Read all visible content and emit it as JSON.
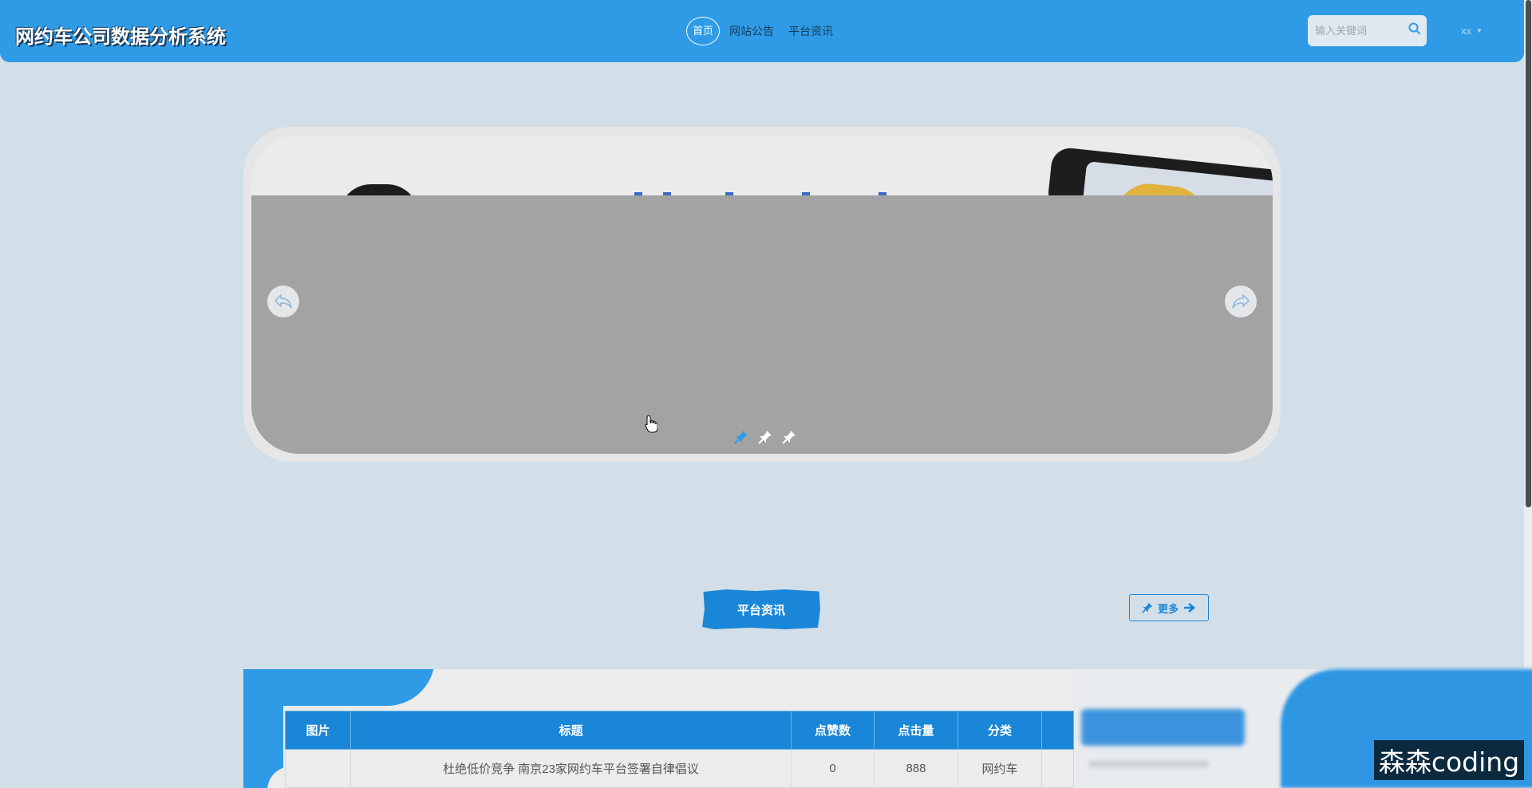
{
  "header": {
    "site_title": "网约车公司数据分析系统",
    "nav": [
      {
        "label": "首页",
        "active": true
      },
      {
        "label": "网站公告",
        "active": false
      },
      {
        "label": "平台资讯",
        "active": false
      }
    ],
    "search_placeholder": "输入关键词",
    "user_label": "xx"
  },
  "banner": {
    "slide_count": 3,
    "active_slide": 1
  },
  "section": {
    "title": "平台资讯",
    "more_label": "更多"
  },
  "news_table": {
    "columns": [
      "图片",
      "标题",
      "点赞数",
      "点击量",
      "分类"
    ],
    "rows": [
      [
        "",
        "杜绝低价竞争 南京23家网约车平台签署自律倡议",
        "0",
        "888",
        "网约车"
      ]
    ]
  },
  "watermark": "森森coding",
  "colors": {
    "primary": "#2f9be6",
    "accent": "#1a86d7",
    "background": "#d2dfe8"
  }
}
